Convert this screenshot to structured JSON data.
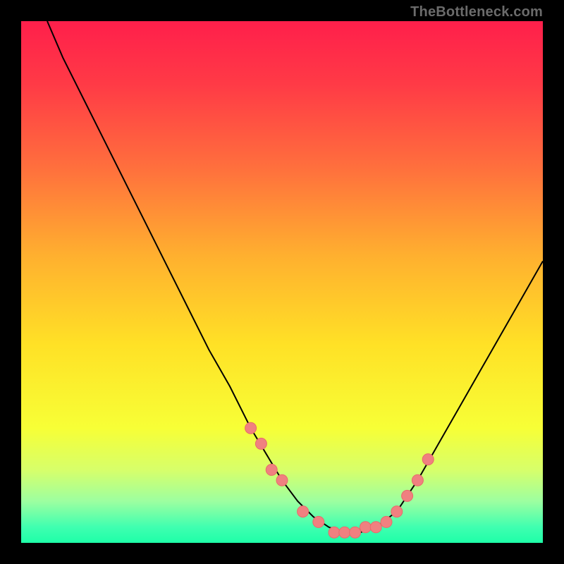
{
  "watermark": "TheBottleneck.com",
  "colors": {
    "gradient_stops": [
      {
        "pct": 0,
        "color": "#ff1f4b"
      },
      {
        "pct": 12,
        "color": "#ff3a46"
      },
      {
        "pct": 28,
        "color": "#ff6f3d"
      },
      {
        "pct": 45,
        "color": "#ffb02f"
      },
      {
        "pct": 62,
        "color": "#ffe126"
      },
      {
        "pct": 78,
        "color": "#f7ff36"
      },
      {
        "pct": 86,
        "color": "#d7ff6a"
      },
      {
        "pct": 92,
        "color": "#9dffa0"
      },
      {
        "pct": 97,
        "color": "#3fffb0"
      },
      {
        "pct": 100,
        "color": "#1effa8"
      }
    ],
    "curve_stroke": "#000000",
    "marker_fill": "#f08080",
    "marker_stroke": "#e86a6a"
  },
  "chart_data": {
    "type": "line",
    "title": "",
    "xlabel": "",
    "ylabel": "",
    "xlim": [
      0,
      100
    ],
    "ylim": [
      0,
      100
    ],
    "grid": false,
    "legend": false,
    "series": [
      {
        "name": "curve",
        "x": [
          5,
          8,
          12,
          16,
          20,
          24,
          28,
          32,
          36,
          40,
          44,
          47,
          50,
          53,
          56,
          59,
          62,
          65,
          68,
          72,
          76,
          80,
          84,
          88,
          92,
          96,
          100
        ],
        "y": [
          100,
          93,
          85,
          77,
          69,
          61,
          53,
          45,
          37,
          30,
          22,
          17,
          12,
          8,
          5,
          3,
          2,
          2,
          3,
          6,
          12,
          19,
          26,
          33,
          40,
          47,
          54
        ]
      }
    ],
    "markers": {
      "name": "highlighted-points",
      "x": [
        44,
        46,
        48,
        50,
        54,
        57,
        60,
        62,
        64,
        66,
        68,
        70,
        72,
        74,
        76,
        78
      ],
      "y": [
        22,
        19,
        14,
        12,
        6,
        4,
        2,
        2,
        2,
        3,
        3,
        4,
        6,
        9,
        12,
        16
      ]
    }
  }
}
